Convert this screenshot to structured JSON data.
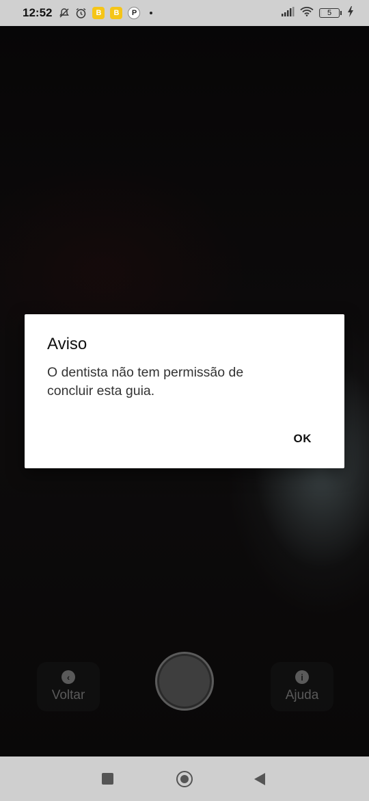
{
  "status_bar": {
    "time": "12:52",
    "battery_level": "5",
    "notification_app_glyph": "B",
    "p_glyph": "P",
    "icons": [
      "bell-off-icon",
      "alarm-icon",
      "notification-app-icon",
      "notification-app-icon",
      "p-icon",
      "dot-icon",
      "signal-icon",
      "wifi-icon",
      "battery-icon",
      "charging-icon"
    ]
  },
  "dialog": {
    "title": "Aviso",
    "message": "O dentista não tem permissão de concluir esta guia.",
    "ok_label": "OK"
  },
  "camera": {
    "back_label": "Voltar",
    "back_icon_glyph": "‹",
    "help_label": "Ajuda",
    "help_icon_glyph": "i"
  },
  "nav_bar": {
    "icons": [
      "recents-icon",
      "home-icon",
      "back-icon"
    ]
  },
  "colors": {
    "status_bar_bg": "#d0d0d0",
    "dialog_bg": "#ffffff",
    "nav_bar_bg": "#cfcfcf"
  }
}
